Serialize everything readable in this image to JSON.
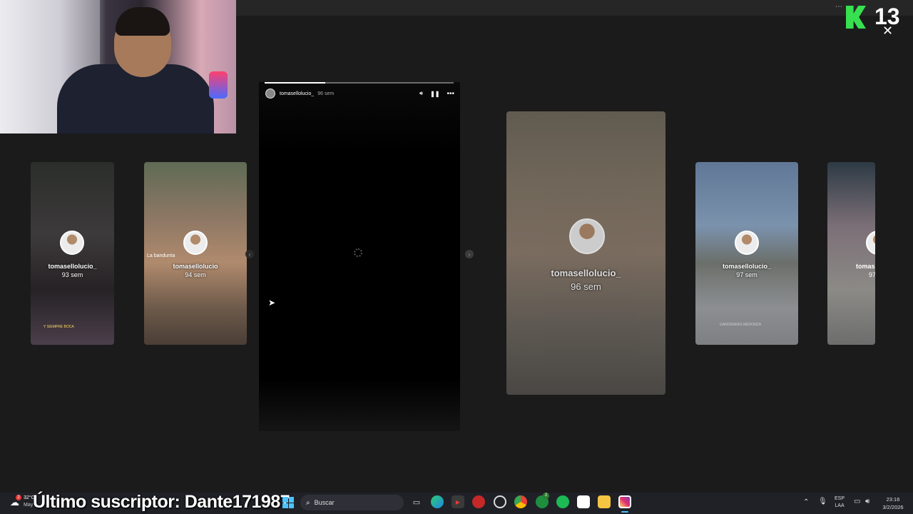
{
  "main_story": {
    "username": "tomasellolucio_",
    "time": "96 sem",
    "progress": 0.32
  },
  "side_stories": [
    {
      "username": "tomasellolucio_",
      "time": "93 sem",
      "caption": "Y SIEMPRE BOCA"
    },
    {
      "username": "tomasellolucio",
      "time": "94 sem",
      "caption": "La bandurria"
    },
    {
      "username": "tomasellolucio_",
      "time": "96 sem"
    },
    {
      "username": "tomasellolucio_",
      "time": "97 sem",
      "caption": "GARDENERS MEDONZA"
    },
    {
      "username": "tomas",
      "time": "97"
    }
  ],
  "brand": {
    "channel_number": "13"
  },
  "overlay": {
    "subscriber_text": "Último suscriptor: Dante171987"
  },
  "taskbar": {
    "weather_temp": "32°C",
    "weather_desc": "May",
    "weather_badge": "2",
    "search_placeholder": "Buscar",
    "lang_primary": "ESP",
    "lang_secondary": "LAA",
    "time": "23:16",
    "date": "3/2/2026",
    "xbox_badge": "2"
  },
  "colors": {
    "brand_green": "#37e04e",
    "taskbar_bg": "#202127",
    "instagram": "#e1306c"
  }
}
